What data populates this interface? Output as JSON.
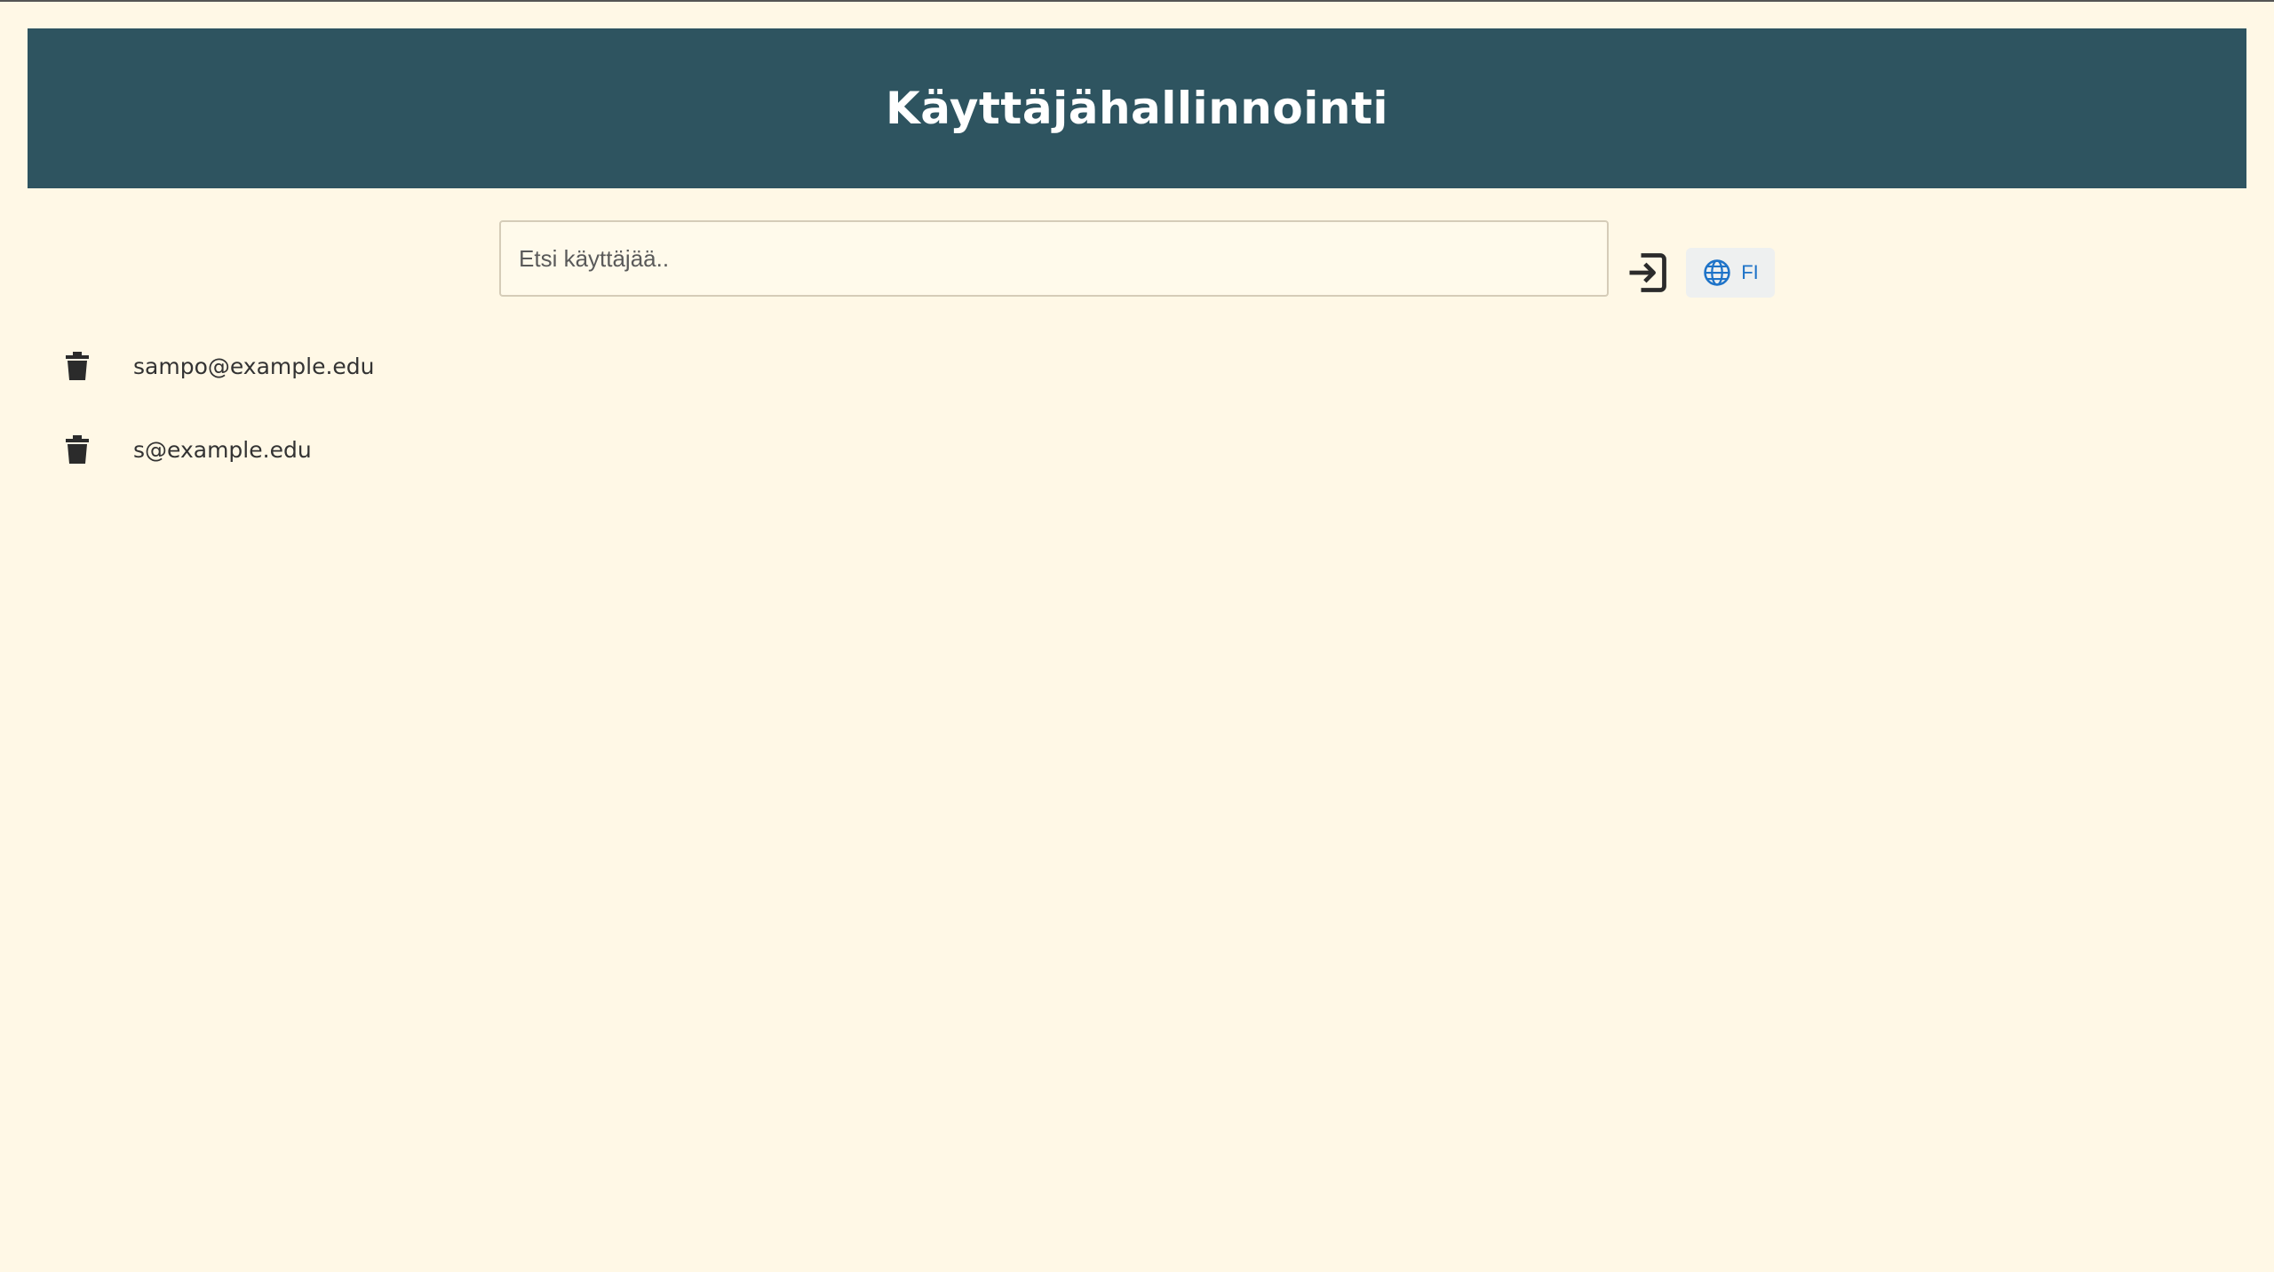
{
  "header": {
    "title": "Käyttäjähallinnointi"
  },
  "search": {
    "placeholder": "Etsi käyttäjää..",
    "value": ""
  },
  "toolbar": {
    "logout_icon": "logout-icon",
    "language": {
      "icon": "globe-icon",
      "label": "FI"
    }
  },
  "users": [
    {
      "email": "sampo@example.edu",
      "action_icon": "trash-icon"
    },
    {
      "email": "s@example.edu",
      "action_icon": "trash-icon"
    }
  ],
  "colors": {
    "background": "#fff8e6",
    "header": "#2e5460",
    "header_text": "#ffffff",
    "accent": "#1e73c8",
    "icon": "#2b2b2b"
  }
}
